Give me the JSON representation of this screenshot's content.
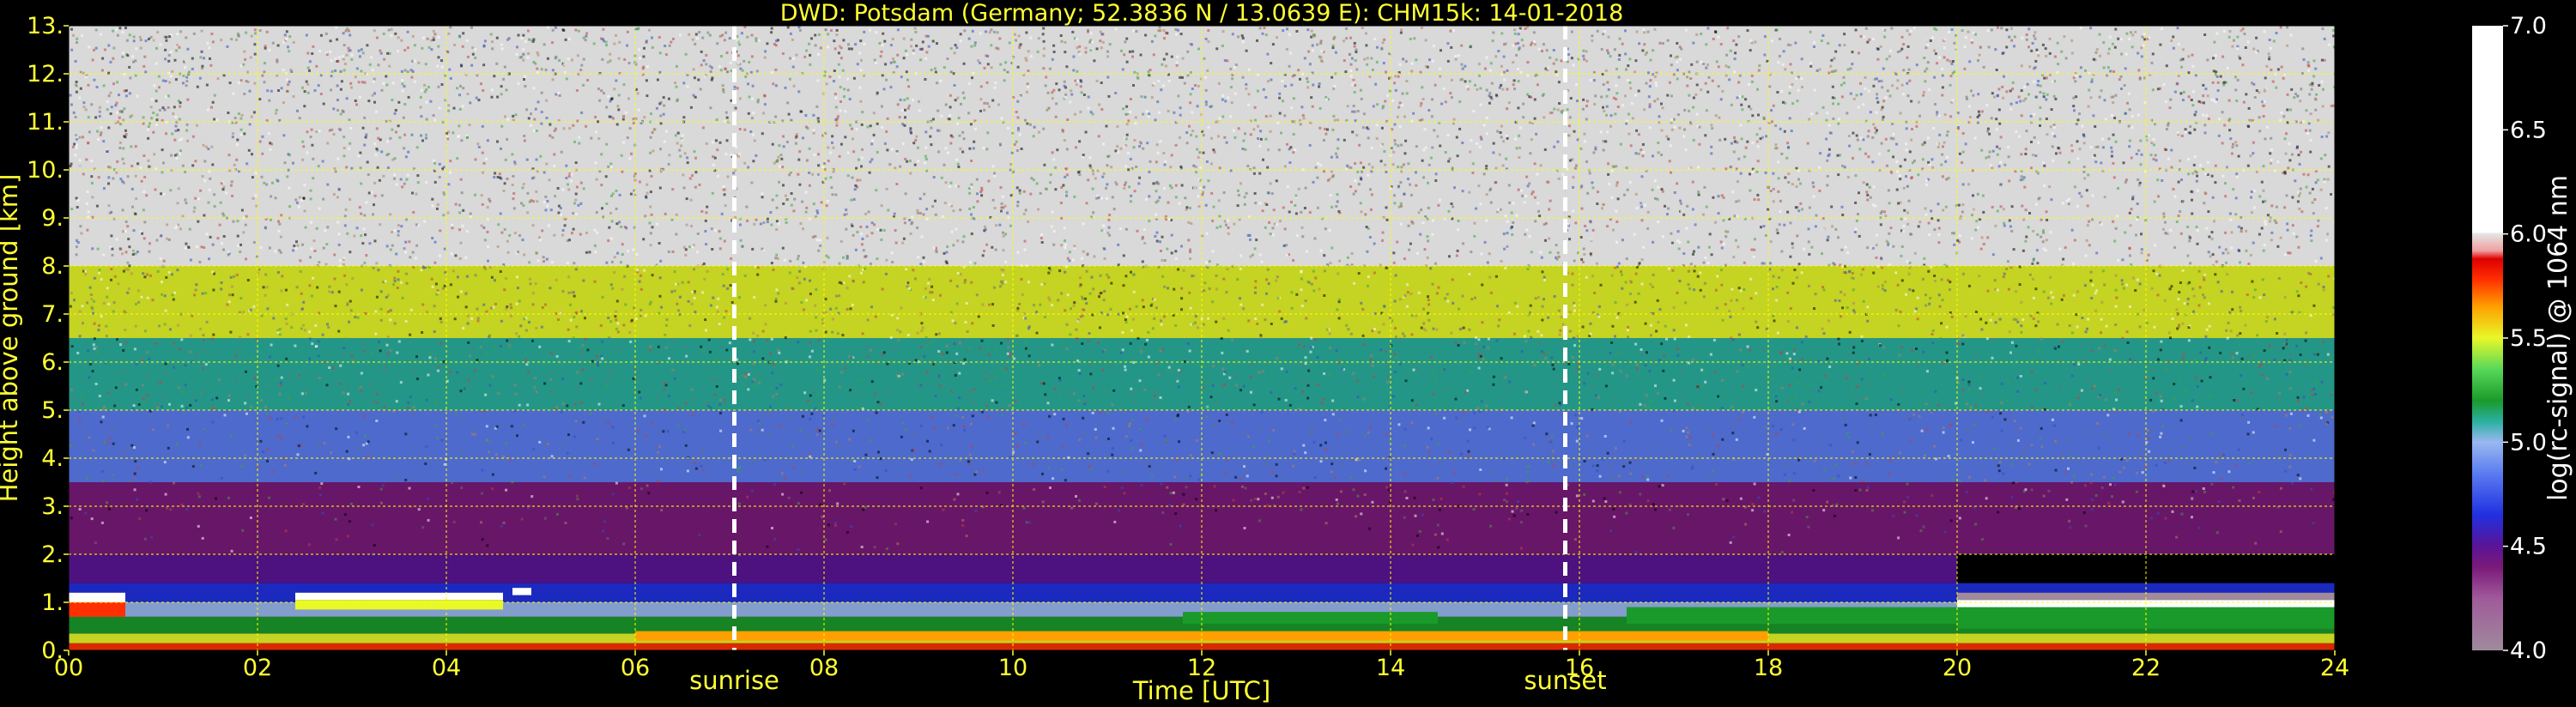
{
  "title": "DWD: Potsdam (Germany; 52.3836 N / 13.0639 E):    CHM15k: 14-01-2018",
  "chart_data": {
    "type": "heatmap",
    "title": "DWD: Potsdam (Germany; 52.3836 N / 13.0639 E):    CHM15k: 14-01-2018",
    "xlabel": "Time [UTC]",
    "ylabel": "Height above ground [km]",
    "xlim": [
      0,
      24
    ],
    "ylim": [
      0,
      13
    ],
    "xticks": [
      0,
      2,
      4,
      6,
      8,
      10,
      12,
      14,
      16,
      18,
      20,
      22,
      24
    ],
    "xtick_labels": [
      "00",
      "02",
      "04",
      "06",
      "08",
      "10",
      "12",
      "14",
      "16",
      "18",
      "20",
      "22",
      "24"
    ],
    "yticks": [
      0,
      1,
      2,
      3,
      4,
      5,
      6,
      7,
      8,
      9,
      10,
      11,
      12,
      13
    ],
    "ytick_labels": [
      "0.",
      "1.",
      "2.",
      "3.",
      "4.",
      "5.",
      "6.",
      "7.",
      "8.",
      "9.",
      "10.",
      "11.",
      "12.",
      "13."
    ],
    "grid": true,
    "grid_color": "#ffff00",
    "events": [
      {
        "name": "sunrise",
        "time": 7.05
      },
      {
        "name": "sunset",
        "time": 15.85
      }
    ],
    "colorbar": {
      "label": "log(rc-signal) @ 1064 nm",
      "range": [
        4.0,
        7.0
      ],
      "ticks": [
        4.0,
        4.5,
        5.0,
        5.5,
        6.0,
        6.5,
        7.0
      ],
      "tick_labels": [
        "4.0",
        "4.5",
        "5.0",
        "5.5",
        "6.0",
        "6.5",
        "7.0"
      ],
      "stops": [
        {
          "v": 4.0,
          "c": "#a08a9c"
        },
        {
          "v": 4.25,
          "c": "#a05a9a"
        },
        {
          "v": 4.4,
          "c": "#7a1a7a"
        },
        {
          "v": 4.5,
          "c": "#5a1496"
        },
        {
          "v": 4.65,
          "c": "#2030e0"
        },
        {
          "v": 4.85,
          "c": "#5a7cf0"
        },
        {
          "v": 5.0,
          "c": "#9ab8f0"
        },
        {
          "v": 5.1,
          "c": "#2ab0a0"
        },
        {
          "v": 5.2,
          "c": "#1a9a2a"
        },
        {
          "v": 5.35,
          "c": "#58d858"
        },
        {
          "v": 5.5,
          "c": "#e8f828"
        },
        {
          "v": 5.65,
          "c": "#ffa000"
        },
        {
          "v": 5.78,
          "c": "#ff3000"
        },
        {
          "v": 5.88,
          "c": "#dd0000"
        },
        {
          "v": 5.92,
          "c": "#f0a0a0"
        },
        {
          "v": 6.0,
          "c": "#e4e4e4"
        },
        {
          "v": 6.01,
          "c": "#ffffff"
        },
        {
          "v": 7.0,
          "c": "#ffffff"
        }
      ]
    },
    "layers": [
      {
        "t0": 0.0,
        "t1": 24.0,
        "h0": 0.0,
        "h1": 0.15,
        "v": 5.8
      },
      {
        "t0": 0.0,
        "t1": 24.0,
        "h0": 0.15,
        "h1": 0.35,
        "v": 5.5
      },
      {
        "t0": 0.0,
        "t1": 24.0,
        "h0": 0.35,
        "h1": 0.7,
        "v": 5.3
      },
      {
        "t0": 0.0,
        "t1": 24.0,
        "h0": 0.7,
        "h1": 1.0,
        "v": 5.0
      },
      {
        "t0": 0.0,
        "t1": 24.0,
        "h0": 1.0,
        "h1": 1.4,
        "v": 4.75
      },
      {
        "t0": 0.0,
        "t1": 20.0,
        "h0": 1.4,
        "h1": 2.0,
        "v": 4.55
      },
      {
        "t0": 0.0,
        "t1": 24.0,
        "h0": 2.0,
        "h1": 3.5,
        "v": 4.45
      },
      {
        "t0": 0.0,
        "t1": 24.0,
        "h0": 3.5,
        "h1": 5.0,
        "v": 4.9
      },
      {
        "t0": 0.0,
        "t1": 24.0,
        "h0": 5.0,
        "h1": 6.5,
        "v": 5.1
      },
      {
        "t0": 0.0,
        "t1": 24.0,
        "h0": 6.5,
        "h1": 8.0,
        "v": 5.5
      },
      {
        "t0": 0.0,
        "t1": 24.0,
        "h0": 8.0,
        "h1": 13.0,
        "v": 6.2
      }
    ],
    "features": [
      {
        "t0": 0.0,
        "t1": 0.6,
        "h0": 1.0,
        "h1": 1.2,
        "v": 7.0
      },
      {
        "t0": 0.0,
        "t1": 0.6,
        "h0": 0.7,
        "h1": 1.0,
        "v": 5.8
      },
      {
        "t0": 2.4,
        "t1": 4.6,
        "h0": 1.05,
        "h1": 1.2,
        "v": 7.0
      },
      {
        "t0": 2.4,
        "t1": 4.6,
        "h0": 0.85,
        "h1": 1.05,
        "v": 5.5
      },
      {
        "t0": 4.7,
        "t1": 4.9,
        "h0": 1.15,
        "h1": 1.3,
        "v": 7.0
      },
      {
        "t0": 6.0,
        "t1": 18.0,
        "h0": 0.2,
        "h1": 0.4,
        "v": 5.65
      },
      {
        "t0": 11.8,
        "t1": 14.5,
        "h0": 0.55,
        "h1": 0.8,
        "v": 5.25
      },
      {
        "t0": 16.5,
        "t1": 20.0,
        "h0": 0.55,
        "h1": 0.9,
        "v": 5.2
      },
      {
        "t0": 20.0,
        "t1": 24.0,
        "h0": 0.45,
        "h1": 0.9,
        "v": 5.2
      },
      {
        "t0": 20.0,
        "t1": 24.0,
        "h0": 0.9,
        "h1": 1.05,
        "v": 7.0
      },
      {
        "t0": 20.0,
        "t1": 24.0,
        "h0": 1.05,
        "h1": 1.2,
        "v": 4.0
      }
    ]
  }
}
